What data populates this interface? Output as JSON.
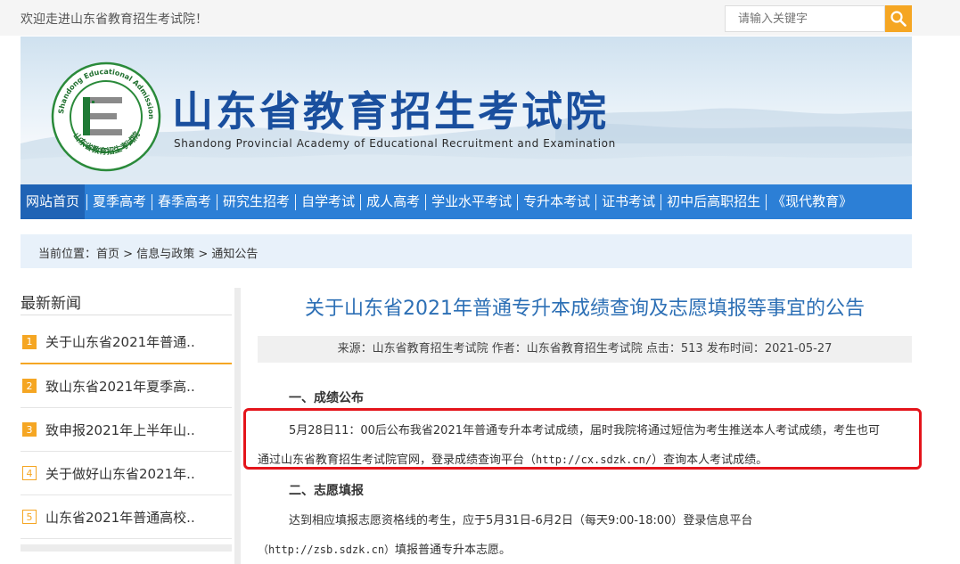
{
  "topbar": {
    "welcome": "欢迎走进山东省教育招生考试院！",
    "search_placeholder": "请输入关键字"
  },
  "banner": {
    "title": "山东省教育招生考试院",
    "subtitle": "Shandong Provincial Academy of Educational Recruitment and Examination",
    "logo_ring_text": "Shandong Educational Admission & Examinations",
    "logo_cn_text": "山东省教育招生考试院"
  },
  "nav": {
    "items": [
      {
        "label": "网站首页"
      },
      {
        "label": "夏季高考"
      },
      {
        "label": "春季高考"
      },
      {
        "label": "研究生招考"
      },
      {
        "label": "自学考试"
      },
      {
        "label": "成人高考"
      },
      {
        "label": "学业水平考试"
      },
      {
        "label": "专升本考试"
      },
      {
        "label": "证书考试"
      },
      {
        "label": "初中后高职招生"
      },
      {
        "label": "《现代教育》"
      }
    ]
  },
  "breadcrumb": {
    "prefix": "当前位置：",
    "items": [
      "首页",
      "信息与政策",
      "通知公告"
    ],
    "separator": " > "
  },
  "sidebar": {
    "title": "最新新闻",
    "items": [
      {
        "num": "1",
        "text": "关于山东省2021年普通.."
      },
      {
        "num": "2",
        "text": "致山东省2021年夏季高.."
      },
      {
        "num": "3",
        "text": "致申报2021年上半年山.."
      },
      {
        "num": "4",
        "text": "关于做好山东省2021年.."
      },
      {
        "num": "5",
        "text": "山东省2021年普通高校.."
      }
    ]
  },
  "article": {
    "title": "关于山东省2021年普通专升本成绩查询及志愿填报等事宜的公告",
    "meta": "来源：山东省教育招生考试院 作者：山东省教育招生考试院 点击：513 发布时间：2021-05-27",
    "section1_title": "一、成绩公布",
    "section1_line1": "5月28日11：00后公布我省2021年普通专升本考试成绩，届时我院将通过短信为考生推送本人考试成绩，考生也可",
    "section1_line2_a": "通过山东省教育招生考试院官网，登录成绩查询平台（",
    "section1_line2_url": "http://cx.sdzk.cn/",
    "section1_line2_b": "）查询本人考试成绩。",
    "section2_title": "二、志愿填报",
    "section2_line1": "达到相应填报志愿资格线的考生，应于5月31日-6月2日（每天9:00-18:00）登录信息平台",
    "section2_line2_url": "（http://zsb.sdzk.cn）",
    "section2_line2_b": "填报普通专升本志愿。"
  }
}
